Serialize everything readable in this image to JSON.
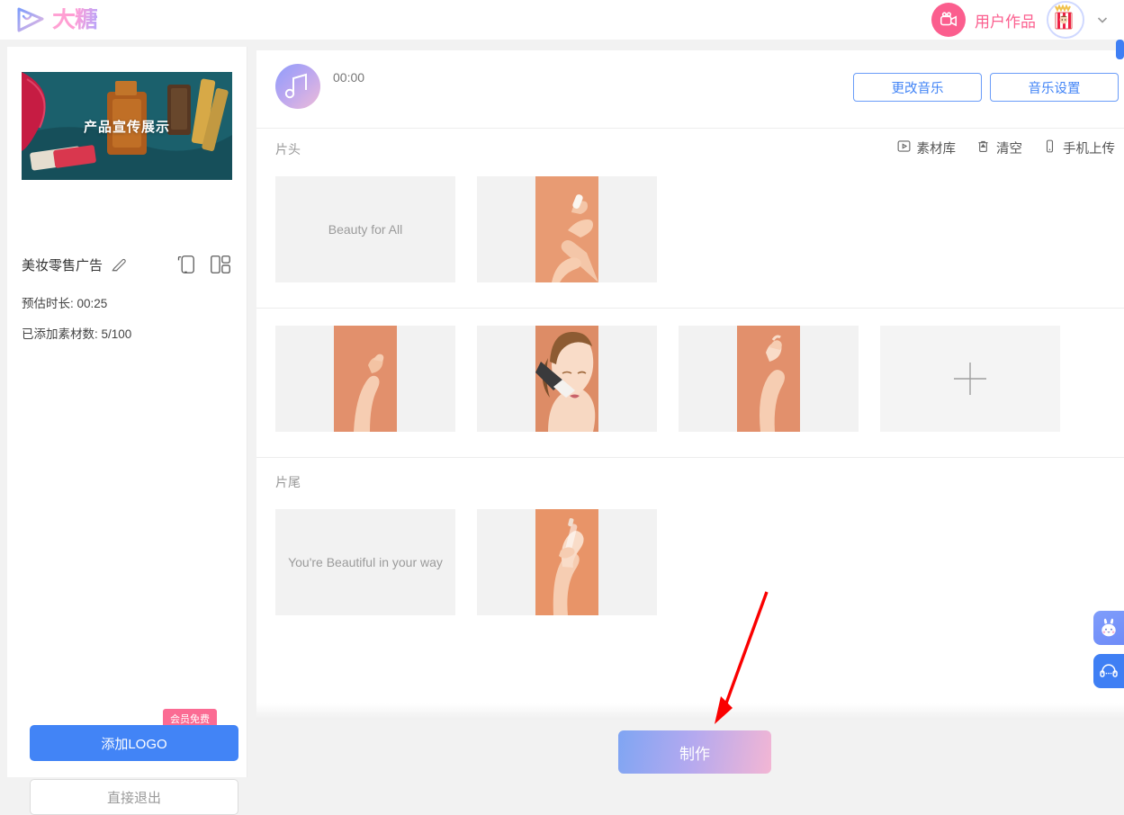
{
  "header": {
    "logo_text": "大糖",
    "logo_icon": "play-triangle-icon",
    "works_label": "用户作品",
    "works_icon": "video-camera-icon",
    "avatar_icon": "popcorn-avatar",
    "chevron_icon": "chevron-down-icon"
  },
  "sidebar": {
    "cover_title": "产品宣传展示",
    "project_name": "美妆零售广告",
    "edit_icon": "pencil-icon",
    "ratio_portrait_icon": "phone-portrait-icon",
    "ratio_grid_icon": "layout-grid-icon",
    "duration_label": "预估时长: 00:25",
    "material_count_label": "已添加素材数: 5/100",
    "vip_badge": "会员免费",
    "add_logo_label": "添加LOGO",
    "exit_label": "直接退出"
  },
  "main": {
    "music": {
      "icon": "music-note-icon",
      "time": "00:00",
      "change_label": "更改音乐",
      "settings_label": "音乐设置"
    },
    "opening": {
      "label": "片头",
      "tools": [
        {
          "label": "素材库",
          "icon": "media-library-icon"
        },
        {
          "label": "清空",
          "icon": "trash-icon"
        },
        {
          "label": "手机上传",
          "icon": "phone-upload-icon"
        }
      ],
      "items": [
        {
          "type": "text",
          "text": "Beauty for All"
        },
        {
          "type": "image",
          "alt": "hand-holding-cosmetic"
        }
      ]
    },
    "middle": {
      "items": [
        {
          "type": "image",
          "alt": "hand-peach-background"
        },
        {
          "type": "image",
          "alt": "woman-applying-makeup-brush"
        },
        {
          "type": "image",
          "alt": "hands-peach-background"
        },
        {
          "type": "add",
          "icon": "plus-icon"
        }
      ]
    },
    "ending": {
      "label": "片尾",
      "items": [
        {
          "type": "text",
          "text": "You're Beautiful in your way"
        },
        {
          "type": "image",
          "alt": "hands-holding-dropper"
        }
      ]
    },
    "make_label": "制作"
  },
  "floating": [
    {
      "name": "mascot-icon",
      "label": ""
    },
    {
      "name": "customer-service-icon",
      "label": ""
    }
  ],
  "colors": {
    "accent_blue": "#4284f6",
    "accent_pink": "#fb5e8e",
    "page_bg": "#f2f2f2",
    "thumb_bg": "#f2f2f2",
    "peach": "#e9936a"
  }
}
